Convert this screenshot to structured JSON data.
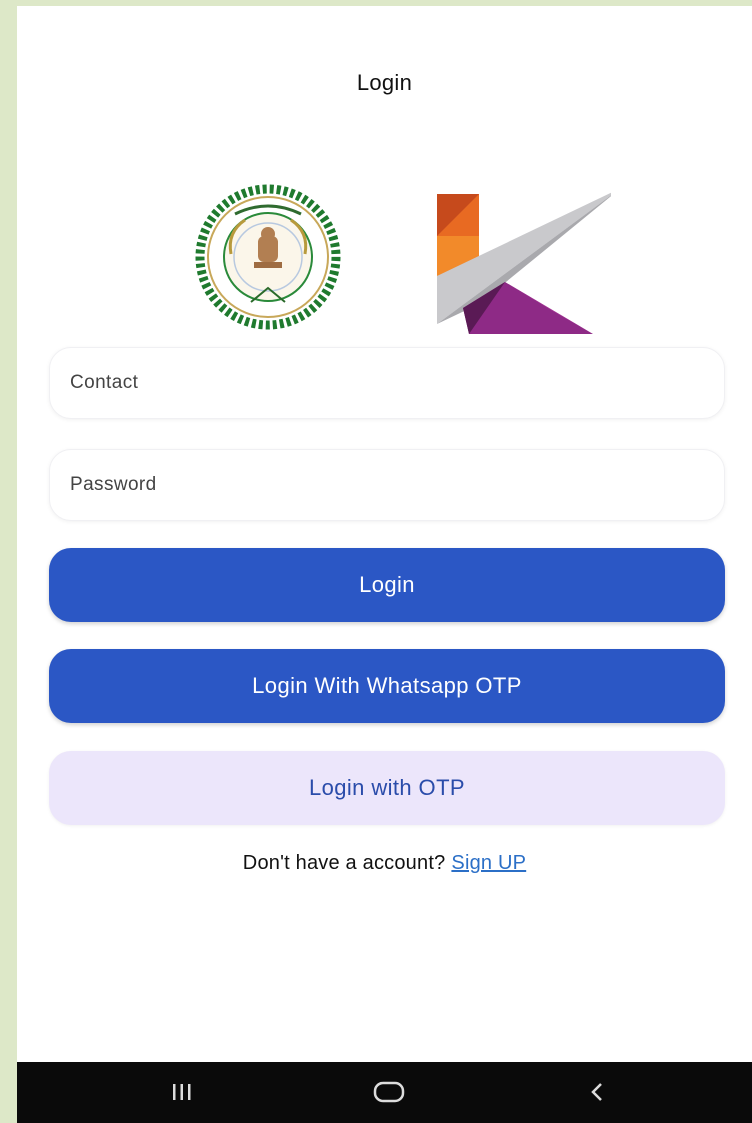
{
  "header": {
    "title": "Login"
  },
  "logos": {
    "state_seal": "state-government-seal-logo",
    "app_logo": "k-logo"
  },
  "form": {
    "contact_placeholder": "Contact",
    "contact_value": "",
    "password_placeholder": "Password",
    "password_value": ""
  },
  "buttons": {
    "login_label": "Login",
    "whatsapp_otp_label": "Login With Whatsapp OTP",
    "otp_label": "Login with OTP"
  },
  "signup": {
    "prompt": "Don't have a account?",
    "link_label": "Sign UP"
  },
  "nav_bar": {
    "recents_icon": "recent-apps-icon",
    "home_icon": "home-icon",
    "back_icon": "back-icon"
  },
  "colors": {
    "primary_button": "#2b57c5",
    "secondary_button": "#ece6fb",
    "secondary_button_text": "#2a4caa",
    "link": "#2b6fc7",
    "nav_bar": "#0a0a0a",
    "page_border": "#dde8c8"
  }
}
